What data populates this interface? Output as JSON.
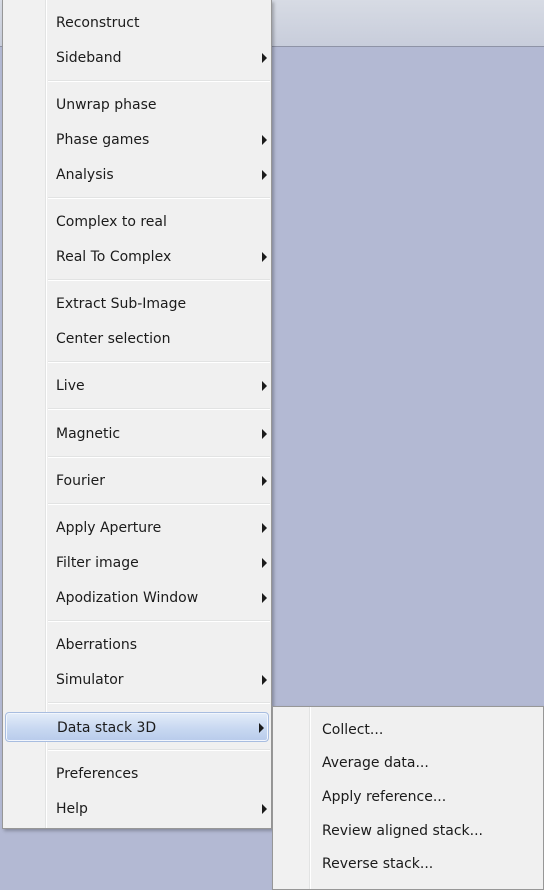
{
  "main_menu": {
    "items": [
      {
        "label": "Reconstruct",
        "submenu": false
      },
      {
        "label": "Sideband",
        "submenu": true
      },
      {
        "label": "Unwrap phase",
        "submenu": false
      },
      {
        "label": "Phase games",
        "submenu": true
      },
      {
        "label": "Analysis",
        "submenu": true
      },
      {
        "label": "Complex to real",
        "submenu": false
      },
      {
        "label": "Real To Complex",
        "submenu": true
      },
      {
        "label": "Extract Sub-Image",
        "submenu": false
      },
      {
        "label": "Center selection",
        "submenu": false
      },
      {
        "label": "Live",
        "submenu": true
      },
      {
        "label": "Magnetic",
        "submenu": true
      },
      {
        "label": "Fourier",
        "submenu": true
      },
      {
        "label": "Apply Aperture",
        "submenu": true
      },
      {
        "label": "Filter image",
        "submenu": true
      },
      {
        "label": "Apodization Window",
        "submenu": true
      },
      {
        "label": "Aberrations",
        "submenu": false
      },
      {
        "label": "Simulator",
        "submenu": true
      },
      {
        "label": "Data stack 3D",
        "submenu": true,
        "highlighted": true
      },
      {
        "label": "Preferences",
        "submenu": false
      },
      {
        "label": "Help",
        "submenu": true
      }
    ]
  },
  "data_stack_submenu": {
    "items": [
      {
        "label": "Collect..."
      },
      {
        "label": "Average data..."
      },
      {
        "label": "Apply reference..."
      },
      {
        "label": "Review aligned stack..."
      },
      {
        "label": "Reverse stack..."
      }
    ]
  },
  "colors": {
    "background": "#b3b9d3",
    "menu_bg": "#f0f0f0",
    "highlight": "#c8d8f1"
  }
}
